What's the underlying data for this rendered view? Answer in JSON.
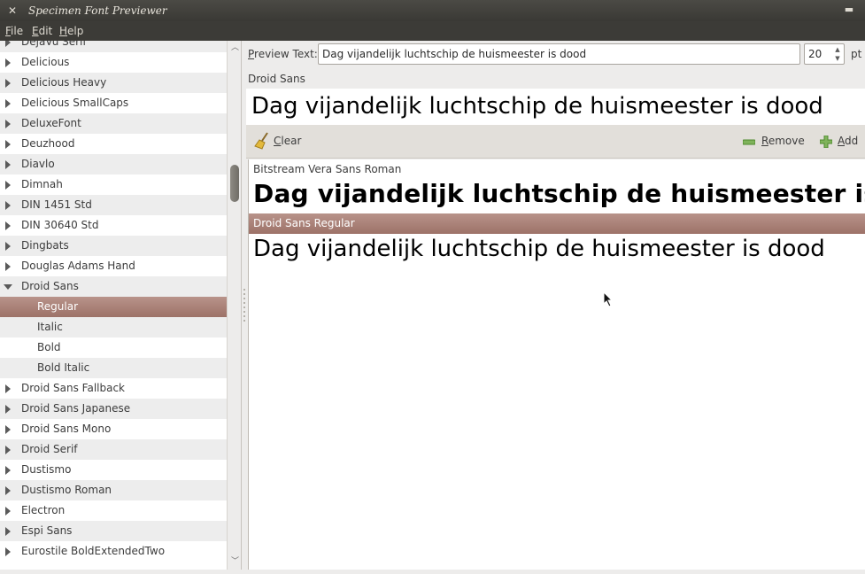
{
  "window": {
    "title": "Specimen Font Previewer"
  },
  "menu": {
    "file": {
      "key": "F",
      "rest": "ile"
    },
    "edit": {
      "key": "E",
      "rest": "dit"
    },
    "help": {
      "key": "H",
      "rest": "elp"
    }
  },
  "tree": {
    "items": [
      {
        "label": "DejaVu Serif",
        "type": "font"
      },
      {
        "label": "Delicious",
        "type": "font"
      },
      {
        "label": "Delicious Heavy",
        "type": "font"
      },
      {
        "label": "Delicious SmallCaps",
        "type": "font"
      },
      {
        "label": "DeluxeFont",
        "type": "font"
      },
      {
        "label": "Deuzhood",
        "type": "font"
      },
      {
        "label": "Diavlo",
        "type": "font"
      },
      {
        "label": "Dimnah",
        "type": "font"
      },
      {
        "label": "DIN 1451 Std",
        "type": "font"
      },
      {
        "label": "DIN 30640 Std",
        "type": "font"
      },
      {
        "label": "Dingbats",
        "type": "font"
      },
      {
        "label": "Douglas Adams Hand",
        "type": "font"
      },
      {
        "label": "Droid Sans",
        "type": "font-open"
      },
      {
        "label": "Regular",
        "type": "style",
        "selected": true
      },
      {
        "label": "Italic",
        "type": "style"
      },
      {
        "label": "Bold",
        "type": "style"
      },
      {
        "label": "Bold Italic",
        "type": "style"
      },
      {
        "label": "Droid Sans Fallback",
        "type": "font"
      },
      {
        "label": "Droid Sans Japanese",
        "type": "font"
      },
      {
        "label": "Droid Sans Mono",
        "type": "font"
      },
      {
        "label": "Droid Serif",
        "type": "font"
      },
      {
        "label": "Dustismo",
        "type": "font"
      },
      {
        "label": "Dustismo Roman",
        "type": "font"
      },
      {
        "label": "Electron",
        "type": "font"
      },
      {
        "label": "Espi Sans",
        "type": "font"
      },
      {
        "label": "Eurostile BoldExtendedTwo",
        "type": "font"
      }
    ]
  },
  "preview": {
    "label_key": "P",
    "label_rest": "review Text:",
    "text": "Dag vijandelijk luchtschip de huismeester is dood",
    "size": "20",
    "unit": "pt",
    "font_name": "Droid Sans"
  },
  "toolbar": {
    "clear_key": "C",
    "clear_rest": "lear",
    "remove_key": "R",
    "remove_rest": "emove",
    "add_key": "A",
    "add_rest": "dd"
  },
  "compare": {
    "items": [
      {
        "name": "Bitstream Vera Sans Roman",
        "text": "Dag vijandelijk luchtschip de huismeester is dood"
      },
      {
        "name": "Droid Sans Regular",
        "text": "Dag vijandelijk luchtschip de huismeester is dood",
        "selected": true
      }
    ]
  },
  "colors": {
    "selection": "#a87f76",
    "titlebar": "#3c3b37"
  }
}
